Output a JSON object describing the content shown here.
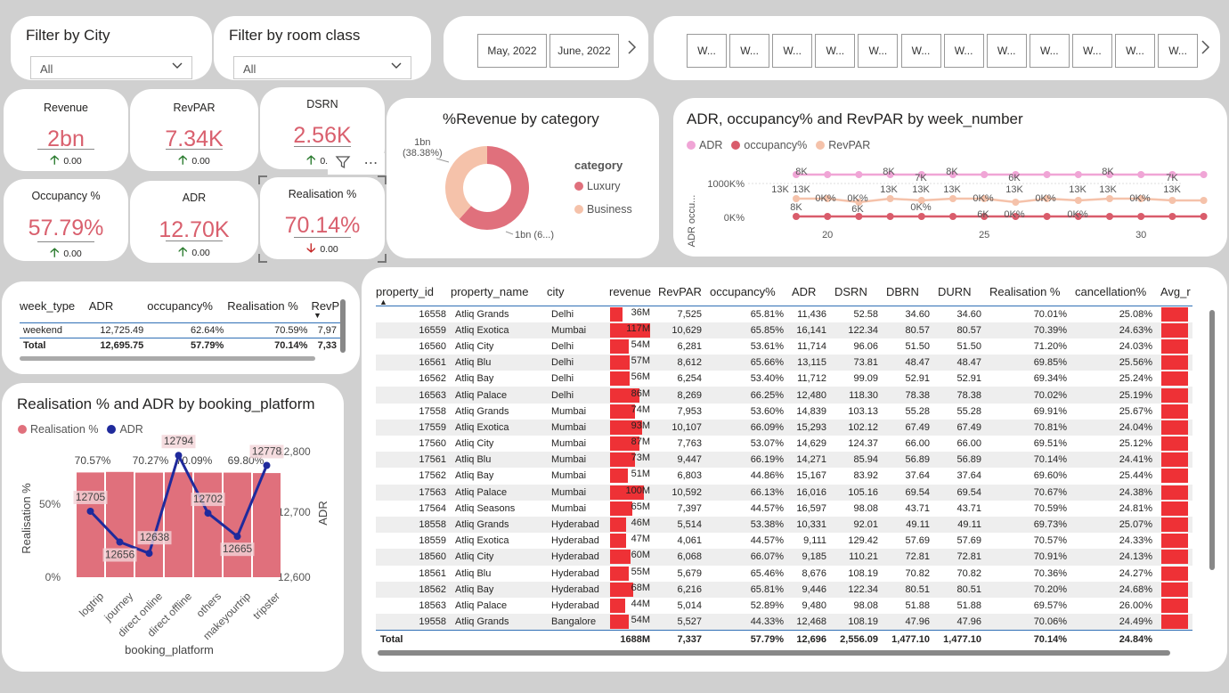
{
  "filters": {
    "city": {
      "title": "Filter by City",
      "value": "All"
    },
    "room_class": {
      "title": "Filter by room class",
      "value": "All"
    }
  },
  "month_slicer": {
    "items": [
      "May, 2022",
      "June, 2022"
    ]
  },
  "week_slicer": {
    "items": [
      "W...",
      "W...",
      "W...",
      "W...",
      "W...",
      "W...",
      "W...",
      "W...",
      "W...",
      "W...",
      "W...",
      "W..."
    ]
  },
  "kpis": {
    "revenue": {
      "label": "Revenue",
      "value": "2bn",
      "delta": "0.00",
      "direction": "up"
    },
    "revpar": {
      "label": "RevPAR",
      "value": "7.34K",
      "delta": "0.00",
      "direction": "up"
    },
    "dsrn": {
      "label": "DSRN",
      "value": "2.56K",
      "delta": "0.00",
      "direction": "up"
    },
    "occupancy": {
      "label": "Occupancy %",
      "value": "57.79%",
      "delta": "0.00",
      "direction": "up"
    },
    "adr": {
      "label": "ADR",
      "value": "12.70K",
      "delta": "0.00",
      "direction": "up"
    },
    "realisation": {
      "label": "Realisation %",
      "value": "70.14%",
      "delta": "0.00",
      "direction": "down"
    }
  },
  "donut": {
    "title": "%Revenue by category",
    "legend_title": "category",
    "label_business": "1bn",
    "label_business_pct": "(38.38%)",
    "label_luxury": "1bn (6...)",
    "colors": {
      "Luxury": "#e0707c",
      "Business": "#f5c2aa"
    }
  },
  "week_chart": {
    "title": "ADR, occupancy% and RevPAR by week_number",
    "legend": [
      {
        "name": "ADR",
        "color": "#f0a5d6"
      },
      {
        "name": "occupancy%",
        "color": "#d95c6b"
      },
      {
        "name": "RevPAR",
        "color": "#f5c2aa"
      }
    ],
    "y_label": "ADR occu...",
    "y_ticks": [
      "1000K%",
      "0K%"
    ],
    "x_ticks": [
      "20",
      "25",
      "30"
    ],
    "data_labels": [
      "8K",
      "13K",
      "13K",
      "8K",
      "8K",
      "6K",
      "0K%",
      "13K",
      "7K",
      "13K",
      "8K",
      "13K",
      "0K%",
      "6K",
      "13K",
      "0K%",
      "13K",
      "8K",
      "13K",
      "0K%",
      "7K",
      "13K",
      "0K%",
      "6K",
      "0K%",
      "0K%",
      "0K%"
    ]
  },
  "week_table": {
    "headers": [
      "week_type",
      "ADR",
      "occupancy%",
      "Realisation %",
      "RevP"
    ],
    "rows": [
      [
        "weekend",
        "12,725.49",
        "62.64%",
        "70.59%",
        "7,97"
      ]
    ],
    "total": [
      "Total",
      "12,695.75",
      "57.79%",
      "70.14%",
      "7,33"
    ]
  },
  "platform_chart": {
    "title": "Realisation % and ADR by booking_platform",
    "legend": [
      {
        "name": "Realisation %",
        "color": "#e0707c"
      },
      {
        "name": "ADR",
        "color": "#1f2a9c"
      }
    ],
    "y_left_label": "Realisation %",
    "y_right_label": "ADR",
    "x_label": "booking_platform",
    "y_left_ticks": [
      "50%",
      "0%"
    ],
    "y_right_ticks": [
      "12,800",
      "12,700",
      "12,600"
    ],
    "realisation_labels": [
      "70.57%",
      "70.27%",
      "70.09%",
      "69.80%"
    ]
  },
  "chart_data": [
    {
      "type": "pie",
      "title": "%Revenue by category",
      "categories": [
        "Luxury",
        "Business"
      ],
      "values": [
        61.62,
        38.38
      ]
    },
    {
      "type": "bar",
      "title": "Realisation % and ADR by booking_platform",
      "xlabel": "booking_platform",
      "categories": [
        "logtrip",
        "journey",
        "direct online",
        "direct offline",
        "others",
        "makeyourtrip",
        "tripster"
      ],
      "series": [
        {
          "name": "Realisation %",
          "values": [
            70.2,
            70.57,
            70.1,
            70.27,
            70.09,
            70.1,
            69.8
          ]
        },
        {
          "name": "ADR",
          "values": [
            12705,
            12656,
            12638,
            12794,
            12702,
            12665,
            12778
          ]
        }
      ],
      "ylim_left": [
        0,
        80
      ],
      "ylim_right": [
        12600,
        12800
      ]
    },
    {
      "type": "line",
      "title": "ADR, occupancy% and RevPAR by week_number",
      "x": [
        19,
        20,
        21,
        22,
        23,
        24,
        25,
        26,
        27,
        28,
        29,
        30,
        31,
        32
      ],
      "series": [
        {
          "name": "ADR",
          "values": [
            13,
            13,
            13,
            13,
            13,
            13,
            13,
            13,
            13,
            13,
            13,
            13,
            13,
            13
          ]
        },
        {
          "name": "occupancy%",
          "values": [
            0,
            0,
            0,
            0,
            0,
            0,
            0,
            0,
            0,
            0,
            0,
            0,
            0,
            0
          ]
        },
        {
          "name": "RevPAR",
          "values": [
            8,
            8,
            6,
            8,
            7,
            8,
            8,
            6,
            8,
            7,
            8,
            8,
            7,
            7
          ]
        }
      ]
    }
  ],
  "property_table": {
    "headers": [
      "property_id",
      "property_name",
      "city",
      "revenue",
      "RevPAR",
      "occupancy%",
      "ADR",
      "DSRN",
      "DBRN",
      "DURN",
      "Realisation %",
      "cancellation%",
      "Avg_r"
    ],
    "rows": [
      [
        "16558",
        "Atliq Grands",
        "Delhi",
        "36M",
        "7,525",
        "65.81%",
        "11,436",
        "52.58",
        "34.60",
        "34.60",
        "70.01%",
        "25.08%"
      ],
      [
        "16559",
        "Atliq Exotica",
        "Mumbai",
        "117M",
        "10,629",
        "65.85%",
        "16,141",
        "122.34",
        "80.57",
        "80.57",
        "70.39%",
        "24.63%"
      ],
      [
        "16560",
        "Atliq City",
        "Delhi",
        "54M",
        "6,281",
        "53.61%",
        "11,714",
        "96.06",
        "51.50",
        "51.50",
        "71.20%",
        "24.03%"
      ],
      [
        "16561",
        "Atliq Blu",
        "Delhi",
        "57M",
        "8,612",
        "65.66%",
        "13,115",
        "73.81",
        "48.47",
        "48.47",
        "69.85%",
        "25.56%"
      ],
      [
        "16562",
        "Atliq Bay",
        "Delhi",
        "56M",
        "6,254",
        "53.40%",
        "11,712",
        "99.09",
        "52.91",
        "52.91",
        "69.34%",
        "25.24%"
      ],
      [
        "16563",
        "Atliq Palace",
        "Delhi",
        "86M",
        "8,269",
        "66.25%",
        "12,480",
        "118.30",
        "78.38",
        "78.38",
        "70.02%",
        "25.19%"
      ],
      [
        "17558",
        "Atliq Grands",
        "Mumbai",
        "74M",
        "7,953",
        "53.60%",
        "14,839",
        "103.13",
        "55.28",
        "55.28",
        "69.91%",
        "25.67%"
      ],
      [
        "17559",
        "Atliq Exotica",
        "Mumbai",
        "93M",
        "10,107",
        "66.09%",
        "15,293",
        "102.12",
        "67.49",
        "67.49",
        "70.81%",
        "24.04%"
      ],
      [
        "17560",
        "Atliq City",
        "Mumbai",
        "87M",
        "7,763",
        "53.07%",
        "14,629",
        "124.37",
        "66.00",
        "66.00",
        "69.51%",
        "25.12%"
      ],
      [
        "17561",
        "Atliq Blu",
        "Mumbai",
        "73M",
        "9,447",
        "66.19%",
        "14,271",
        "85.94",
        "56.89",
        "56.89",
        "70.14%",
        "24.41%"
      ],
      [
        "17562",
        "Atliq Bay",
        "Mumbai",
        "51M",
        "6,803",
        "44.86%",
        "15,167",
        "83.92",
        "37.64",
        "37.64",
        "69.60%",
        "25.44%"
      ],
      [
        "17563",
        "Atliq Palace",
        "Mumbai",
        "100M",
        "10,592",
        "66.13%",
        "16,016",
        "105.16",
        "69.54",
        "69.54",
        "70.67%",
        "24.38%"
      ],
      [
        "17564",
        "Atliq Seasons",
        "Mumbai",
        "65M",
        "7,397",
        "44.57%",
        "16,597",
        "98.08",
        "43.71",
        "43.71",
        "70.59%",
        "24.81%"
      ],
      [
        "18558",
        "Atliq Grands",
        "Hyderabad",
        "46M",
        "5,514",
        "53.38%",
        "10,331",
        "92.01",
        "49.11",
        "49.11",
        "69.73%",
        "25.07%"
      ],
      [
        "18559",
        "Atliq Exotica",
        "Hyderabad",
        "47M",
        "4,061",
        "44.57%",
        "9,111",
        "129.42",
        "57.69",
        "57.69",
        "70.57%",
        "24.33%"
      ],
      [
        "18560",
        "Atliq City",
        "Hyderabad",
        "60M",
        "6,068",
        "66.07%",
        "9,185",
        "110.21",
        "72.81",
        "72.81",
        "70.91%",
        "24.13%"
      ],
      [
        "18561",
        "Atliq Blu",
        "Hyderabad",
        "55M",
        "5,679",
        "65.46%",
        "8,676",
        "108.19",
        "70.82",
        "70.82",
        "70.36%",
        "24.27%"
      ],
      [
        "18562",
        "Atliq Bay",
        "Hyderabad",
        "68M",
        "6,216",
        "65.81%",
        "9,446",
        "122.34",
        "80.51",
        "80.51",
        "70.20%",
        "24.68%"
      ],
      [
        "18563",
        "Atliq Palace",
        "Hyderabad",
        "44M",
        "5,014",
        "52.89%",
        "9,480",
        "98.08",
        "51.88",
        "51.88",
        "69.57%",
        "26.00%"
      ],
      [
        "19558",
        "Atliq Grands",
        "Bangalore",
        "54M",
        "5,527",
        "44.33%",
        "12,468",
        "108.19",
        "47.96",
        "47.96",
        "70.06%",
        "24.49%"
      ]
    ],
    "revenue_values": [
      36,
      117,
      54,
      57,
      56,
      86,
      74,
      93,
      87,
      73,
      51,
      100,
      65,
      46,
      47,
      60,
      55,
      68,
      44,
      54
    ],
    "total": [
      "Total",
      "",
      "",
      "1688M",
      "7,337",
      "57.79%",
      "12,696",
      "2,556.09",
      "1,477.10",
      "1,477.10",
      "70.14%",
      "24.84%"
    ]
  }
}
